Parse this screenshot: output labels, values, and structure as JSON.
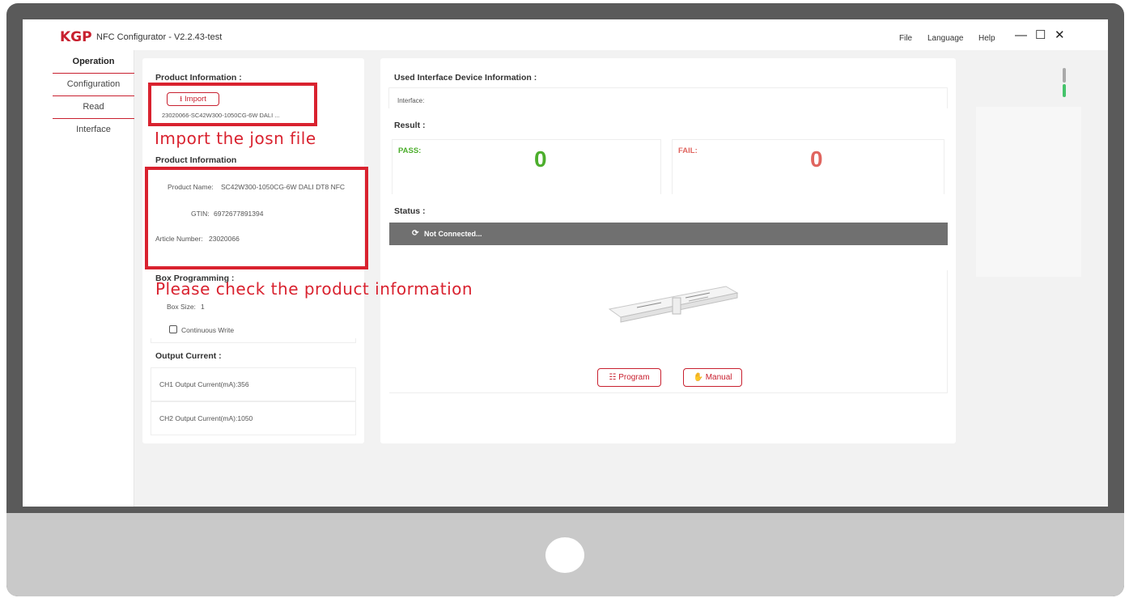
{
  "app": {
    "logo": "KGP",
    "title": "NFC Configurator - V2.2.43-test"
  },
  "menu": {
    "file": "File",
    "language": "Language",
    "help": "Help"
  },
  "window_controls": {
    "minimize": "—",
    "maximize": "☐",
    "close": "✕"
  },
  "sidebar": {
    "items": [
      {
        "label": "Operation",
        "active": true
      },
      {
        "label": "Configuration",
        "active": false
      },
      {
        "label": "Read",
        "active": false
      },
      {
        "label": "Interface",
        "active": false
      }
    ]
  },
  "left_panel": {
    "product_info_heading": "Product Information :",
    "import_button": "Import",
    "import_icon": "upload-icon",
    "file_name": "23020066-SC42W300-1050CG-6W DALI ...",
    "product_info_subheading": "Product Information",
    "product_name_label": "Product Name:",
    "product_name_value": "SC42W300-1050CG-6W DALI DT8 NFC",
    "gtin_label": "GTIN:",
    "gtin_value": "6972677891394",
    "article_label": "Article Number:",
    "article_value": "23020066",
    "box_programming_heading": "Box Programming :",
    "box_size_label": "Box Size:",
    "box_size_value": "1",
    "continuous_write_label": "Continuous Write",
    "continuous_write_checked": false,
    "output_current_heading": "Output Current :",
    "ch1_label": "CH1 Output Current(mA):356",
    "ch2_label": "CH2 Output Current(mA):1050"
  },
  "right_panel": {
    "device_info_heading": "Used Interface Device Information :",
    "interface_label": "Interface:",
    "result_heading": "Result :",
    "pass_label": "PASS:",
    "pass_value": "0",
    "fail_label": "FAIL:",
    "fail_value": "0",
    "status_heading": "Status :",
    "status_text": "Not Connected...",
    "status_icon": "refresh-icon",
    "program_button": "Program",
    "manual_button": "Manual",
    "program_icon": "chip-icon",
    "manual_icon": "hand-icon"
  },
  "annotations": {
    "import_note": "Import the josn file",
    "check_note": "Please check the product information"
  },
  "colors": {
    "brand_red": "#c8202f",
    "annotation_red": "#d9222f",
    "pass_green": "#4cae2c",
    "fail_red": "#e0655f",
    "status_bar_grey": "#707070",
    "bezel": "#5a5a5a",
    "chin": "#c9c9c9"
  }
}
